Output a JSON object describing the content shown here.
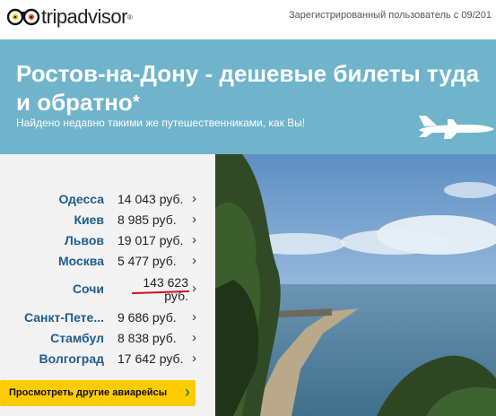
{
  "header": {
    "logo_text": "tripadvisor",
    "logo_reg": "®",
    "registered_user": "Зарегистрированный пользователь с 09/201"
  },
  "banner": {
    "title_line1": "Ростов-на-Дону - дешевые билеты туда",
    "title_line2": "и обратно",
    "asterisk": "*",
    "subtitle": "Найдено недавно такими же путешественниками, как Вы!"
  },
  "destinations": [
    {
      "city": "Одесса",
      "price": "14 043 руб."
    },
    {
      "city": "Киев",
      "price": "8 985 руб."
    },
    {
      "city": "Львов",
      "price": "19 017 руб."
    },
    {
      "city": "Москва",
      "price": "5 477 руб."
    },
    {
      "city": "Сочи",
      "price_line1": "143 623",
      "price_line2": "руб."
    },
    {
      "city": "Санкт-Пете...",
      "price": "9 686 руб."
    },
    {
      "city": "Стамбул",
      "price": "8 838 руб."
    },
    {
      "city": "Волгоград",
      "price": "17 642 руб."
    }
  ],
  "chevron": "›",
  "cta": {
    "label": "Просмотреть другие авиарейсы",
    "chevron": "›"
  },
  "colors": {
    "banner": "#6fb4cb",
    "city_link": "#1f5d8c",
    "cta": "#ffcc00",
    "underline": "#d4101a"
  }
}
